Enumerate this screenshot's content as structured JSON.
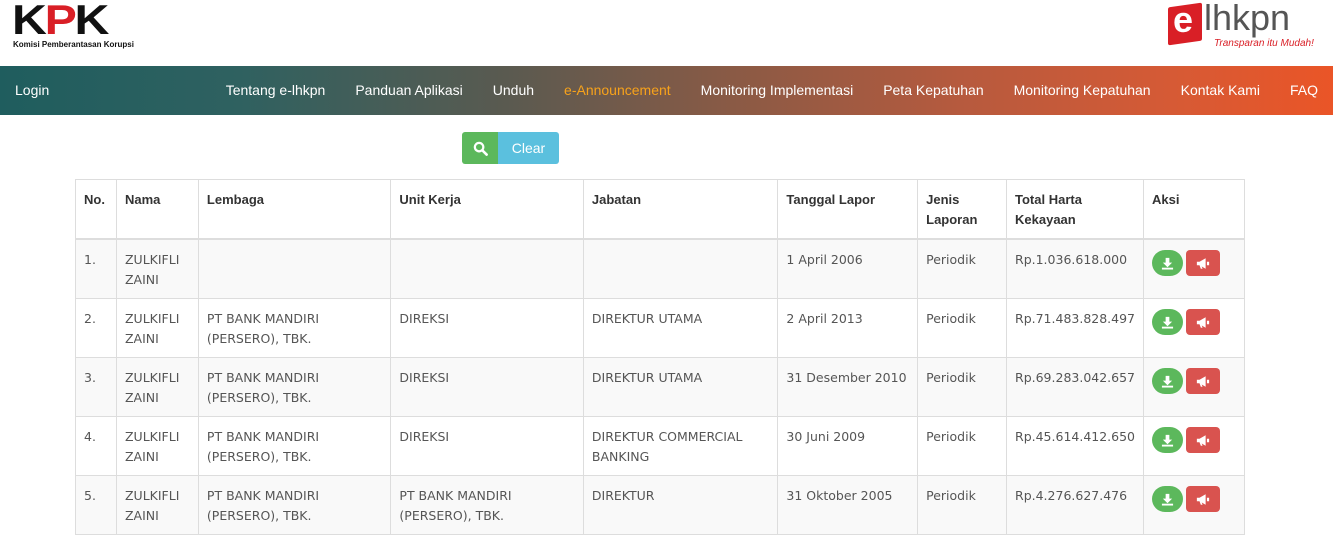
{
  "header": {
    "kpk_logo_text": "KPK",
    "kpk_subtitle": "Komisi Pemberantasan Korupsi",
    "elhkpn_logo_e": "e",
    "elhkpn_logo_word": "lhkpn",
    "elhkpn_tagline": "Transparan itu Mudah!"
  },
  "nav": {
    "login": "Login",
    "items": [
      {
        "label": "Tentang e-lhkpn",
        "active": false
      },
      {
        "label": "Panduan Aplikasi",
        "active": false
      },
      {
        "label": "Unduh",
        "active": false
      },
      {
        "label": "e-Announcement",
        "active": true
      },
      {
        "label": "Monitoring Implementasi",
        "active": false
      },
      {
        "label": "Peta Kepatuhan",
        "active": false
      },
      {
        "label": "Monitoring Kepatuhan",
        "active": false
      },
      {
        "label": "Kontak Kami",
        "active": false
      },
      {
        "label": "FAQ",
        "active": false
      }
    ],
    "active_color": "#f7a21b"
  },
  "search": {
    "search_icon": "search-icon",
    "clear_label": "Clear"
  },
  "table": {
    "headers": [
      "No.",
      "Nama",
      "Lembaga",
      "Unit Kerja",
      "Jabatan",
      "Tanggal Lapor",
      "Jenis Laporan",
      "Total Harta Kekayaan",
      "Aksi"
    ],
    "rows": [
      {
        "no": "1.",
        "nama": "ZULKIFLI ZAINI",
        "lembaga": "",
        "unit_kerja": "",
        "jabatan": "",
        "tanggal": "1 April 2006",
        "jenis": "Periodik",
        "total": "Rp.1.036.618.000"
      },
      {
        "no": "2.",
        "nama": "ZULKIFLI ZAINI",
        "lembaga": "PT BANK MANDIRI (PERSERO), TBK.",
        "unit_kerja": "DIREKSI",
        "jabatan": "DIREKTUR UTAMA",
        "tanggal": "2 April 2013",
        "jenis": "Periodik",
        "total": "Rp.71.483.828.497"
      },
      {
        "no": "3.",
        "nama": "ZULKIFLI ZAINI",
        "lembaga": "PT BANK MANDIRI (PERSERO), TBK.",
        "unit_kerja": "DIREKSI",
        "jabatan": "DIREKTUR UTAMA",
        "tanggal": "31 Desember 2010",
        "jenis": "Periodik",
        "total": "Rp.69.283.042.657"
      },
      {
        "no": "4.",
        "nama": "ZULKIFLI ZAINI",
        "lembaga": "PT BANK MANDIRI (PERSERO), TBK.",
        "unit_kerja": "DIREKSI",
        "jabatan": "DIREKTUR COMMERCIAL BANKING",
        "tanggal": "30 Juni 2009",
        "jenis": "Periodik",
        "total": "Rp.45.614.412.650"
      },
      {
        "no": "5.",
        "nama": "ZULKIFLI ZAINI",
        "lembaga": "PT BANK MANDIRI (PERSERO), TBK.",
        "unit_kerja": "PT BANK MANDIRI (PERSERO), TBK.",
        "jabatan": "DIREKTUR",
        "tanggal": "31 Oktober 2005",
        "jenis": "Periodik",
        "total": "Rp.4.276.627.476"
      }
    ],
    "action_icons": [
      "download-icon",
      "announcement-icon"
    ]
  },
  "colors": {
    "green": "#5cb85c",
    "cyan": "#5bc0de",
    "red": "#d9534f",
    "brand_red": "#d91f26"
  }
}
